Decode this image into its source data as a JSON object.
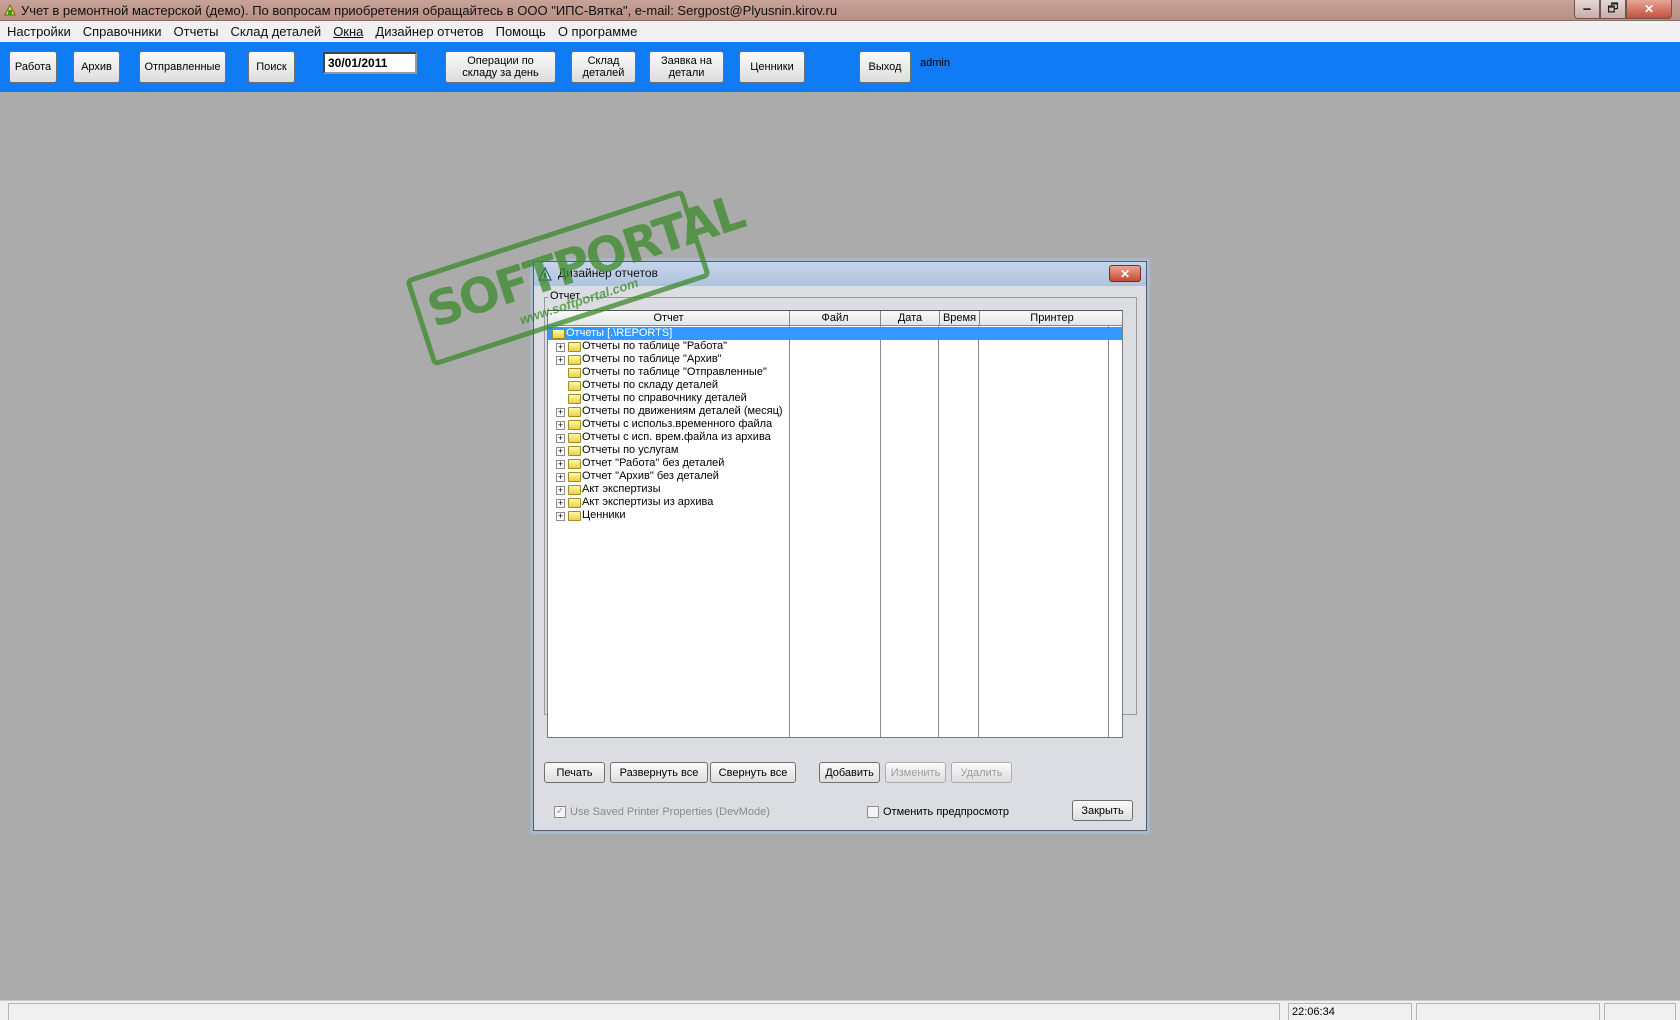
{
  "window": {
    "title": "Учет в ремонтной мастерской (демо). По вопросам приобретения обращайтесь в ООО \"ИПС-Вятка\", e-mail: Sergpost@Plyusnin.kirov.ru",
    "controls": [
      "🗕",
      "🗗",
      "✕"
    ]
  },
  "menu": [
    "Настройки",
    "Справочники",
    "Отчеты",
    "Склад деталей",
    "Окна",
    "Дизайнер отчетов",
    "Помощь",
    "О программе"
  ],
  "toolbar": {
    "buttons": {
      "work": "Работа",
      "archive": "Архив",
      "sent": "Отправленные",
      "search": "Поиск",
      "ops_line1": "Операции по",
      "ops_line2": "складу за день",
      "store_line1": "Склад",
      "store_line2": "деталей",
      "request_line1": "Заявка на",
      "request_line2": "детали",
      "prices": "Ценники",
      "exit": "Выход"
    },
    "date": "30/01/2011",
    "user": "admin"
  },
  "watermark": {
    "brand": "SOFTPORTAL",
    "url": "www.softportal.com"
  },
  "dialog": {
    "title": "Дизайнер отчетов",
    "group_label": "Отчет",
    "columns": [
      "Отчет",
      "Файл",
      "Дата",
      "Время",
      "Принтер"
    ],
    "tree": [
      {
        "label": "Отчеты [.\\REPORTS]",
        "level": 0,
        "expander": "",
        "selected": true
      },
      {
        "label": "Отчеты по таблице \"Работа\"",
        "level": 1,
        "expander": "+"
      },
      {
        "label": "Отчеты по таблице \"Архив\"",
        "level": 1,
        "expander": "+"
      },
      {
        "label": "Отчеты по таблице \"Отправленные\"",
        "level": 1,
        "expander": ""
      },
      {
        "label": "Отчеты по складу деталей",
        "level": 1,
        "expander": ""
      },
      {
        "label": "Отчеты по справочнику деталей",
        "level": 1,
        "expander": ""
      },
      {
        "label": "Отчеты по движениям деталей (месяц)",
        "level": 1,
        "expander": "+"
      },
      {
        "label": "Отчеты с использ.временного файла",
        "level": 1,
        "expander": "+"
      },
      {
        "label": "Отчеты с исп. врем.файла из архива",
        "level": 1,
        "expander": "+"
      },
      {
        "label": "Отчеты по услугам",
        "level": 1,
        "expander": "+"
      },
      {
        "label": "Отчет \"Работа\" без деталей",
        "level": 1,
        "expander": "+"
      },
      {
        "label": "Отчет \"Архив\" без деталей",
        "level": 1,
        "expander": "+"
      },
      {
        "label": "Акт экспертизы",
        "level": 1,
        "expander": "+"
      },
      {
        "label": "Акт экспертизы из архива",
        "level": 1,
        "expander": "+"
      },
      {
        "label": "Ценники",
        "level": 1,
        "expander": "+"
      }
    ],
    "buttons": {
      "print": "Печать",
      "expand_all": "Развернуть все",
      "collapse_all": "Свернуть все",
      "add": "Добавить",
      "edit": "Изменить",
      "delete": "Удалить",
      "close": "Закрыть"
    },
    "checkboxes": {
      "devmode": {
        "label": "Use Saved Printer Properties (DevMode)",
        "checked": true,
        "disabled": true
      },
      "no_preview": {
        "label": "Отменить предпросмотр",
        "checked": false
      }
    }
  },
  "status": {
    "time": "22:06:34"
  }
}
